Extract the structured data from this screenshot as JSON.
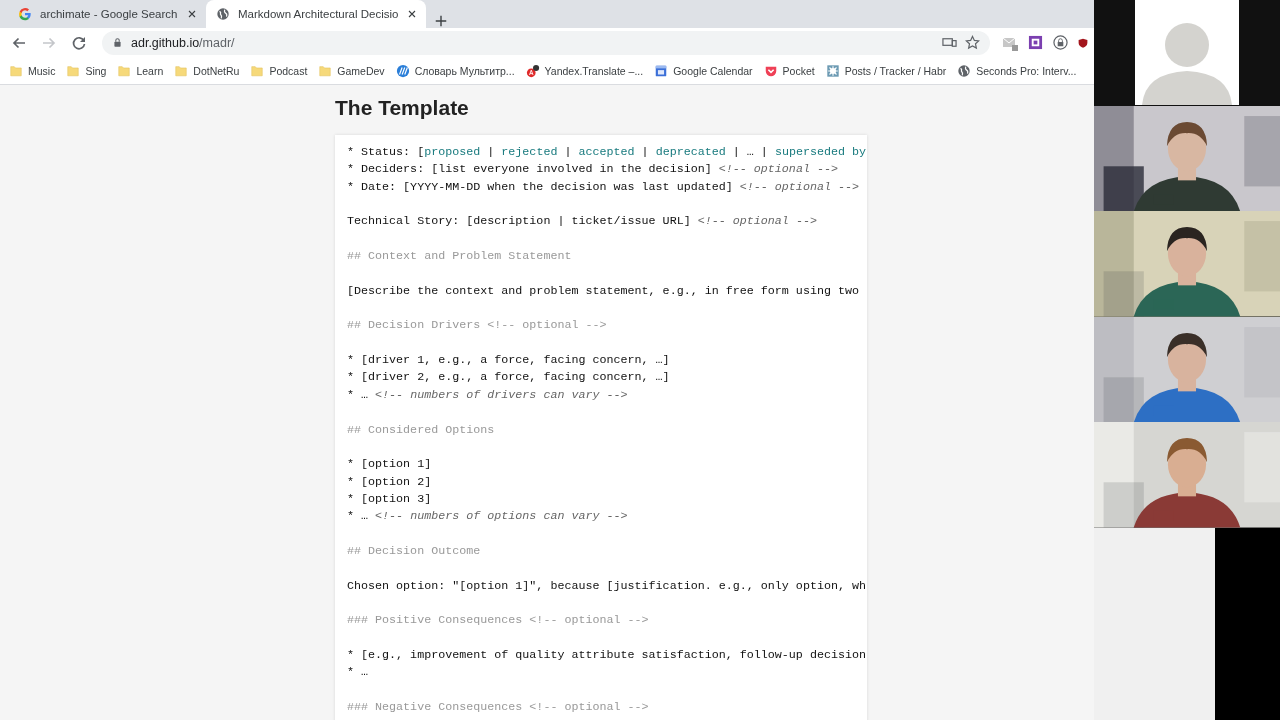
{
  "tabs": [
    {
      "title": "archimate - Google Search",
      "kind": "google",
      "selected": false
    },
    {
      "title": "Markdown Architectural Decisio",
      "kind": "globe",
      "selected": true
    }
  ],
  "navigation": [
    {
      "kind": "back",
      "disabled": false
    },
    {
      "kind": "forward",
      "disabled": true
    },
    {
      "kind": "reload",
      "disabled": false
    }
  ],
  "address": {
    "host": "adr.github.io",
    "path": "/madr/"
  },
  "bookmarks": [
    {
      "label": "Music",
      "kind": "folder"
    },
    {
      "label": "Sing",
      "kind": "folder"
    },
    {
      "label": "Learn",
      "kind": "folder"
    },
    {
      "label": "DotNetRu",
      "kind": "folder"
    },
    {
      "label": "Podcast",
      "kind": "folder"
    },
    {
      "label": "GameDev",
      "kind": "folder"
    },
    {
      "label": "Словарь Мультитр...",
      "kind": "dictionary"
    },
    {
      "label": "Yandex.Translate –...",
      "kind": "translate"
    },
    {
      "label": "Google Calendar",
      "kind": "calendar"
    },
    {
      "label": "Pocket",
      "kind": "pocket"
    },
    {
      "label": "Posts / Tracker / Habr",
      "kind": "habr"
    },
    {
      "label": "Seconds Pro: Interv...",
      "kind": "globe"
    }
  ],
  "page": {
    "title": "The Template",
    "lines": [
      {
        "kind": "text",
        "segments": [
          {
            "kind": "plain",
            "text": "* Status: ["
          },
          {
            "kind": "value",
            "text": "proposed"
          },
          {
            "kind": "plain",
            "text": " | "
          },
          {
            "kind": "value",
            "text": "rejected"
          },
          {
            "kind": "plain",
            "text": " | "
          },
          {
            "kind": "value",
            "text": "accepted"
          },
          {
            "kind": "plain",
            "text": " | "
          },
          {
            "kind": "value",
            "text": "deprecated"
          },
          {
            "kind": "plain",
            "text": " | … | "
          },
          {
            "kind": "value",
            "text": "superseded by"
          }
        ]
      },
      {
        "kind": "text",
        "segments": [
          {
            "kind": "plain",
            "text": "* Deciders: [list everyone involved in the decision] "
          },
          {
            "kind": "comment",
            "text": "<!-- optional -->"
          }
        ]
      },
      {
        "kind": "text",
        "segments": [
          {
            "kind": "plain",
            "text": "* Date: [YYYY-MM-DD when the decision was last updated] "
          },
          {
            "kind": "comment",
            "text": "<!-- optional -->"
          }
        ]
      },
      {
        "kind": "blank"
      },
      {
        "kind": "text",
        "segments": [
          {
            "kind": "plain",
            "text": "Technical Story: [description | ticket/issue URL] "
          },
          {
            "kind": "comment",
            "text": "<!-- optional -->"
          }
        ]
      },
      {
        "kind": "blank"
      },
      {
        "kind": "text",
        "segments": [
          {
            "kind": "heading",
            "text": "## Context and Problem Statement"
          }
        ]
      },
      {
        "kind": "blank"
      },
      {
        "kind": "text",
        "segments": [
          {
            "kind": "plain",
            "text": "[Describe the context and problem statement, e.g., in free form using two"
          }
        ]
      },
      {
        "kind": "blank"
      },
      {
        "kind": "text",
        "segments": [
          {
            "kind": "heading",
            "text": "## Decision Drivers <!-- optional -->"
          }
        ]
      },
      {
        "kind": "blank"
      },
      {
        "kind": "text",
        "segments": [
          {
            "kind": "plain",
            "text": "* [driver 1, e.g., a force, facing concern, …]"
          }
        ]
      },
      {
        "kind": "text",
        "segments": [
          {
            "kind": "plain",
            "text": "* [driver 2, e.g., a force, facing concern, …]"
          }
        ]
      },
      {
        "kind": "text",
        "segments": [
          {
            "kind": "plain",
            "text": "* … "
          },
          {
            "kind": "comment",
            "text": "<!-- numbers of drivers can vary -->"
          }
        ]
      },
      {
        "kind": "blank"
      },
      {
        "kind": "text",
        "segments": [
          {
            "kind": "heading",
            "text": "## Considered Options"
          }
        ]
      },
      {
        "kind": "blank"
      },
      {
        "kind": "text",
        "segments": [
          {
            "kind": "plain",
            "text": "* [option 1]"
          }
        ]
      },
      {
        "kind": "text",
        "segments": [
          {
            "kind": "plain",
            "text": "* [option 2]"
          }
        ]
      },
      {
        "kind": "text",
        "segments": [
          {
            "kind": "plain",
            "text": "* [option 3]"
          }
        ]
      },
      {
        "kind": "text",
        "segments": [
          {
            "kind": "plain",
            "text": "* … "
          },
          {
            "kind": "comment",
            "text": "<!-- numbers of options can vary -->"
          }
        ]
      },
      {
        "kind": "blank"
      },
      {
        "kind": "text",
        "segments": [
          {
            "kind": "heading",
            "text": "## Decision Outcome"
          }
        ]
      },
      {
        "kind": "blank"
      },
      {
        "kind": "text",
        "segments": [
          {
            "kind": "plain",
            "text": "Chosen option: \"[option 1]\", because [justification. e.g., only option, wh"
          }
        ]
      },
      {
        "kind": "blank"
      },
      {
        "kind": "text",
        "segments": [
          {
            "kind": "heading",
            "text": "### Positive Consequences <!-- optional -->"
          }
        ]
      },
      {
        "kind": "blank"
      },
      {
        "kind": "text",
        "segments": [
          {
            "kind": "plain",
            "text": "* [e.g., improvement of quality attribute satisfaction, follow-up decision"
          }
        ]
      },
      {
        "kind": "text",
        "segments": [
          {
            "kind": "plain",
            "text": "* …"
          }
        ]
      },
      {
        "kind": "blank"
      },
      {
        "kind": "text",
        "segments": [
          {
            "kind": "heading",
            "text": "### Negative Consequences <!-- optional -->"
          }
        ]
      }
    ]
  },
  "video_tiles": [
    {
      "kind": "avatar"
    },
    {
      "kind": "picture"
    },
    {
      "kind": "picture"
    },
    {
      "kind": "picture"
    },
    {
      "kind": "picture"
    }
  ]
}
